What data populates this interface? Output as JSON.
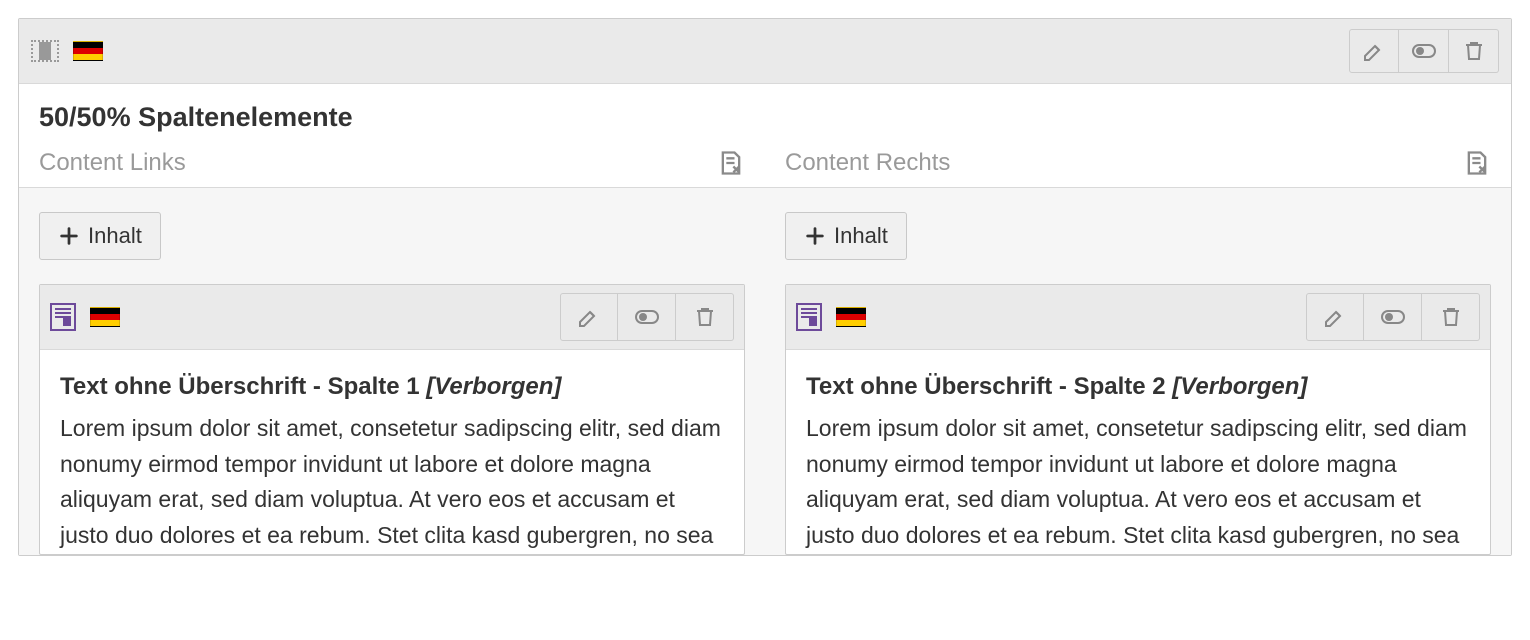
{
  "main": {
    "title": "50/50% Spaltenelemente"
  },
  "columns": {
    "left": {
      "label": "Content Links",
      "add_label": "Inhalt",
      "card": {
        "title": "Text ohne Überschrift - Spalte 1",
        "status": "[Verborgen]",
        "body": "Lorem ipsum dolor sit amet, consetetur sadipscing elitr, sed diam nonumy eirmod tempor invidunt ut labore et dolore magna aliquyam erat, sed diam voluptua. At vero eos et accusam et justo duo dolores et ea rebum. Stet clita kasd gubergren, no sea"
      }
    },
    "right": {
      "label": "Content Rechts",
      "add_label": "Inhalt",
      "card": {
        "title": "Text ohne Überschrift - Spalte 2",
        "status": "[Verborgen]",
        "body": "Lorem ipsum dolor sit amet, consetetur sadipscing elitr, sed diam nonumy eirmod tempor invidunt ut labore et dolore magna aliquyam erat, sed diam voluptua. At vero eos et accusam et justo duo dolores et ea rebum. Stet clita kasd gubergren, no sea"
      }
    }
  }
}
